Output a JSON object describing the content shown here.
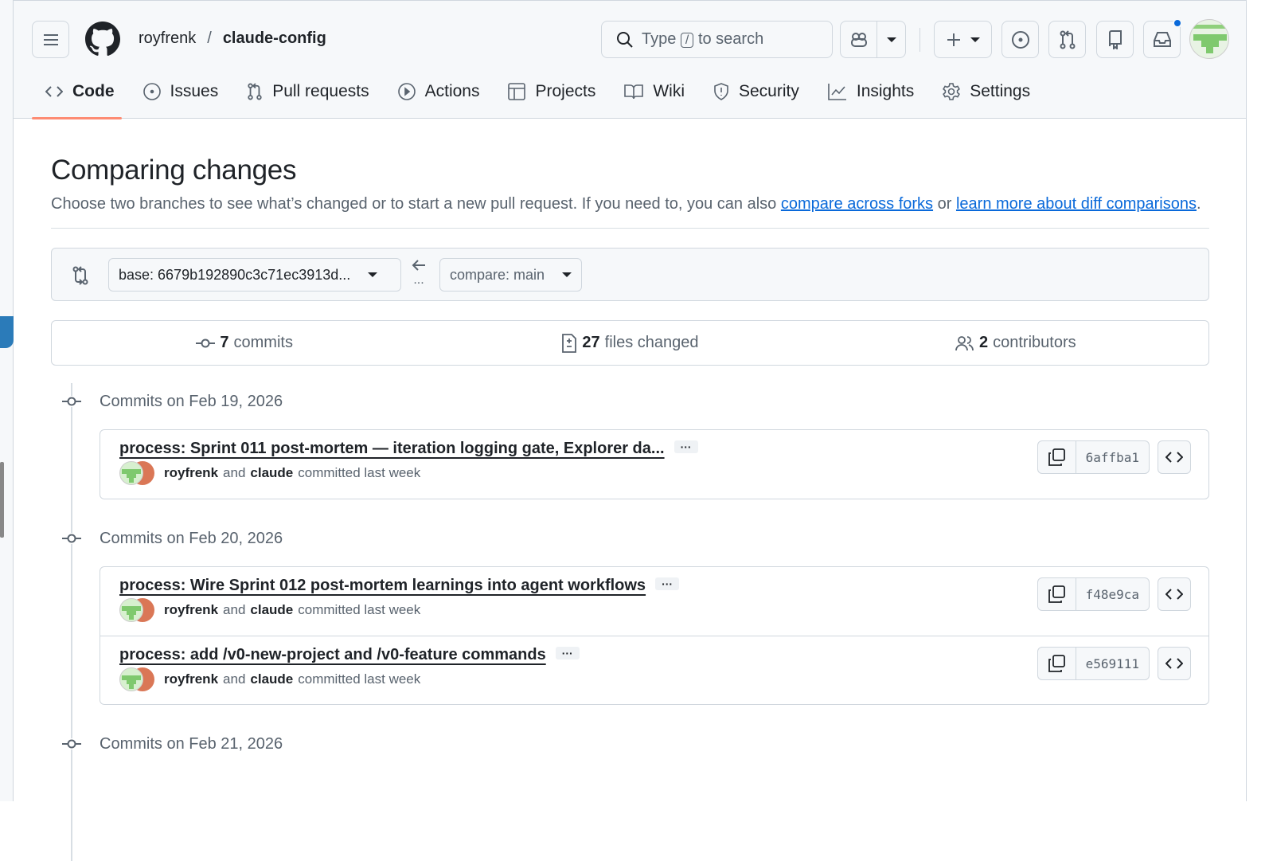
{
  "header": {
    "owner": "royfrenk",
    "separator": "/",
    "repo": "claude-config",
    "search_prefix": "Type",
    "search_key": "/",
    "search_suffix": "to search"
  },
  "nav": [
    {
      "label": "Code",
      "icon": "code-icon"
    },
    {
      "label": "Issues",
      "icon": "issue-icon"
    },
    {
      "label": "Pull requests",
      "icon": "pull-request-icon"
    },
    {
      "label": "Actions",
      "icon": "play-icon"
    },
    {
      "label": "Projects",
      "icon": "table-icon"
    },
    {
      "label": "Wiki",
      "icon": "book-icon"
    },
    {
      "label": "Security",
      "icon": "shield-icon"
    },
    {
      "label": "Insights",
      "icon": "graph-icon"
    },
    {
      "label": "Settings",
      "icon": "gear-icon"
    }
  ],
  "main": {
    "title": "Comparing changes",
    "desc": "Choose two branches to see what’s changed or to start a new pull request. If you need to, you can also",
    "link1": "compare across forks",
    "or": "or",
    "link2": "learn more about diff comparisons",
    "period": ".",
    "base": "base: 6679b192890c3c71ec3913d...",
    "compare": "compare: main",
    "range_dots": "...",
    "stats": {
      "commits_n": "7",
      "commits_l": "commits",
      "files_n": "27",
      "files_l": "files changed",
      "contrib_n": "2",
      "contrib_l": "contributors"
    },
    "groups": [
      {
        "date": "Commits on Feb 19, 2026",
        "commits": [
          {
            "title": "process: Sprint 011 post-mortem — iteration logging gate, Explorer da...",
            "author": "royfrenk",
            "and": "and",
            "coauthor": "claude",
            "when": "committed last week",
            "sha": "6affba1"
          }
        ]
      },
      {
        "date": "Commits on Feb 20, 2026",
        "commits": [
          {
            "title": "process: Wire Sprint 012 post-mortem learnings into agent workflows",
            "author": "royfrenk",
            "and": "and",
            "coauthor": "claude",
            "when": "committed last week",
            "sha": "f48e9ca"
          },
          {
            "title": "process: add /v0-new-project and /v0-feature commands",
            "author": "royfrenk",
            "and": "and",
            "coauthor": "claude",
            "when": "committed last week",
            "sha": "e569111"
          }
        ]
      },
      {
        "date": "Commits on Feb 21, 2026",
        "commits": []
      }
    ],
    "ellipsis": "···"
  }
}
